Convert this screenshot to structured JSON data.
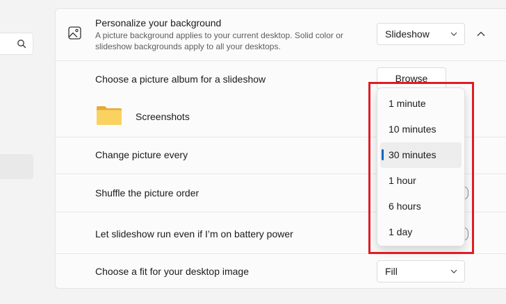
{
  "nav": {
    "search_icon": "search-icon"
  },
  "background": {
    "title": "Personalize your background",
    "description": "A picture background applies to your current desktop. Solid color or slideshow backgrounds apply to all your desktops.",
    "type_value": "Slideshow"
  },
  "album": {
    "label": "Choose a picture album for a slideshow",
    "browse_label": "Browse",
    "folder_name": "Screenshots"
  },
  "change_every": {
    "label": "Change picture every",
    "options": [
      "1 minute",
      "10 minutes",
      "30 minutes",
      "1 hour",
      "6 hours",
      "1 day"
    ],
    "selected": "30 minutes"
  },
  "shuffle": {
    "label": "Shuffle the picture order"
  },
  "battery": {
    "label": "Let slideshow run even if I’m on battery power"
  },
  "fit": {
    "label": "Choose a fit for your desktop image",
    "value": "Fill"
  },
  "colors": {
    "accent": "#0067c0",
    "annotation": "#e01b24",
    "folder": "#f7c948"
  }
}
